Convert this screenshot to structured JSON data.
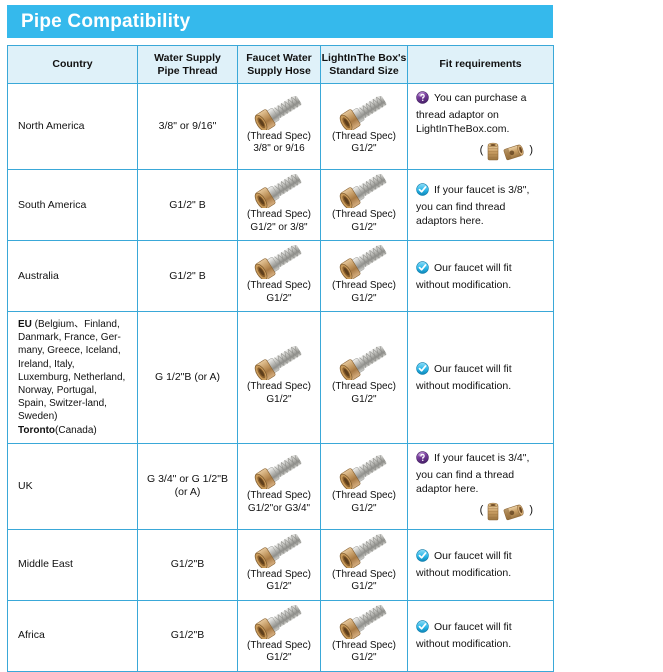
{
  "banner": {
    "title": "Pipe Compatibility",
    "background_color": "#35b9ec",
    "text_color": "#ffffff"
  },
  "table": {
    "border_color": "#3aa8d8",
    "header_background": "#dff1f9",
    "columns": [
      {
        "key": "country",
        "label_line1": "Country",
        "label_line2": ""
      },
      {
        "key": "pipe_thread",
        "label_line1": "Water Supply",
        "label_line2": "Pipe Thread"
      },
      {
        "key": "faucet_hose",
        "label_line1": "Faucet Water",
        "label_line2": "Supply Hose"
      },
      {
        "key": "litb_size",
        "label_line1": "LightInThe Box's",
        "label_line2": "Standard Size"
      },
      {
        "key": "fit",
        "label_line1": "Fit requirements",
        "label_line2": ""
      }
    ],
    "rows": [
      {
        "country": "North America",
        "country_bold_prefix": "",
        "pipe_thread": "3/8\" or 9/16\"",
        "hose_caption_line1": "(Thread Spec)",
        "hose_caption_line2": "3/8\" or 9/16",
        "litb_caption_line1": "(Thread Spec)",
        "litb_caption_line2": "G1/2\"",
        "fit_icon": "purple-question-icon",
        "fit_icon_color": "#7b3fa0",
        "fit_text": "You can purchase a thread adaptor on LightInTheBox.com.",
        "has_adaptor_images": true,
        "adaptor_open_paren": "(",
        "adaptor_close_paren": ")"
      },
      {
        "country": "South America",
        "country_bold_prefix": "",
        "pipe_thread": "G1/2\" B",
        "hose_caption_line1": "(Thread Spec)",
        "hose_caption_line2": "G1/2\" or 3/8\"",
        "litb_caption_line1": "(Thread Spec)",
        "litb_caption_line2": "G1/2\"",
        "fit_icon": "blue-check-icon",
        "fit_icon_color": "#29b6e8",
        "fit_text": "If your faucet is 3/8\", you can find thread adaptors here.",
        "has_adaptor_images": false,
        "adaptor_open_paren": "",
        "adaptor_close_paren": ""
      },
      {
        "country": "Australia",
        "country_bold_prefix": "",
        "pipe_thread": "G1/2\" B",
        "hose_caption_line1": "(Thread Spec)",
        "hose_caption_line2": "G1/2\"",
        "litb_caption_line1": "(Thread Spec)",
        "litb_caption_line2": "G1/2\"",
        "fit_icon": "blue-check-icon",
        "fit_icon_color": "#29b6e8",
        "fit_text": "Our faucet will fit without modification.",
        "has_adaptor_images": false,
        "adaptor_open_paren": "",
        "adaptor_close_paren": ""
      },
      {
        "country": "EU  (Belgium、Finland, Danmark, France, Ger-many, Greece, Iceland, Ireland, Italy, Luxemburg, Netherland, Norway, Portugal, Spain, Switzer-land, Sweden)",
        "country_bold_prefix": "EU",
        "country_rest": "  (Belgium、Finland, Danmark, France, Ger-many, Greece, Iceland, Ireland, Italy, Luxemburg, Netherland, Norway, Portugal, Spain, Switzer-land, Sweden)",
        "country_second_bold": "Toronto",
        "country_second_rest": "(Canada)",
        "pipe_thread": "G 1/2\"B  (or A)",
        "hose_caption_line1": "(Thread Spec)",
        "hose_caption_line2": "G1/2\"",
        "litb_caption_line1": "(Thread Spec)",
        "litb_caption_line2": "G1/2\"",
        "fit_icon": "blue-check-icon",
        "fit_icon_color": "#29b6e8",
        "fit_text": "Our faucet will fit without modification.",
        "has_adaptor_images": false,
        "adaptor_open_paren": "",
        "adaptor_close_paren": ""
      },
      {
        "country": "UK",
        "country_bold_prefix": "",
        "pipe_thread": "G 3/4\" or G 1/2\"B (or A)",
        "pipe_thread_line1": "G 3/4\" or G 1/2\"B",
        "pipe_thread_line2": "(or A)",
        "hose_caption_line1": "(Thread Spec)",
        "hose_caption_line2": "G1/2\"or G3/4\"",
        "litb_caption_line1": "(Thread Spec)",
        "litb_caption_line2": "G1/2\"",
        "fit_icon": "purple-question-icon",
        "fit_icon_color": "#7b3fa0",
        "fit_text": "If your faucet is 3/4\", you can find a thread adaptor here.",
        "has_adaptor_images": true,
        "adaptor_open_paren": "(",
        "adaptor_close_paren": ")"
      },
      {
        "country": "Middle East",
        "country_bold_prefix": "",
        "pipe_thread": "G1/2\"B",
        "hose_caption_line1": "(Thread Spec)",
        "hose_caption_line2": "G1/2\"",
        "litb_caption_line1": "(Thread Spec)",
        "litb_caption_line2": "G1/2\"",
        "fit_icon": "blue-check-icon",
        "fit_icon_color": "#29b6e8",
        "fit_text": "Our faucet will fit without modification.",
        "has_adaptor_images": false,
        "adaptor_open_paren": "",
        "adaptor_close_paren": ""
      },
      {
        "country": "Africa",
        "country_bold_prefix": "",
        "pipe_thread": "G1/2\"B",
        "hose_caption_line1": "(Thread Spec)",
        "hose_caption_line2": "G1/2\"",
        "litb_caption_line1": "(Thread Spec)",
        "litb_caption_line2": "G1/2\"",
        "fit_icon": "blue-check-icon",
        "fit_icon_color": "#29b6e8",
        "fit_text": "Our faucet will fit without modification.",
        "has_adaptor_images": false,
        "adaptor_open_paren": "",
        "adaptor_close_paren": ""
      }
    ]
  }
}
